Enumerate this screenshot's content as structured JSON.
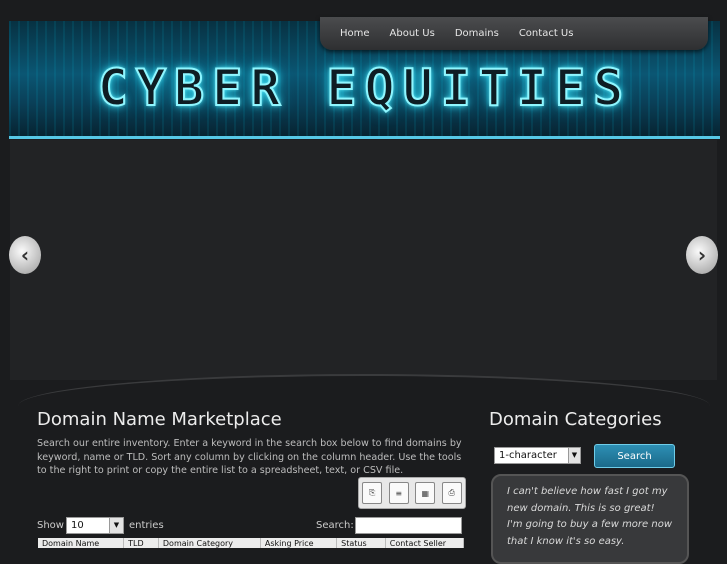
{
  "header": {
    "logo_text": "CYBER EQUITIES"
  },
  "nav": {
    "items": [
      {
        "label": "Home"
      },
      {
        "label": "About Us"
      },
      {
        "label": "Domains"
      },
      {
        "label": "Contact Us"
      }
    ]
  },
  "slider": {
    "prev_glyph": "‹",
    "next_glyph": "›"
  },
  "main": {
    "title": "Domain Name Marketplace",
    "intro": "Search our entire inventory. Enter a keyword in the search box below to find domains by keyword, name or TLD. Sort any column by clicking on the column header. Use the tools to the right to print or copy the entire list to a spreadsheet, text, or CSV file.",
    "tools": [
      "copy-icon",
      "csv-icon",
      "excel-icon",
      "print-icon"
    ],
    "show_label": "Show",
    "entries_value": "10",
    "entries_label": "entries",
    "search_label": "Search:",
    "search_value": "",
    "columns": [
      "Domain Name",
      "TLD",
      "Domain Category",
      "Asking Price",
      "Status",
      "Contact Seller"
    ]
  },
  "sidebar": {
    "title": "Domain Categories",
    "category_value": "1-character",
    "search_button": "Search",
    "testimonial": "I can't believe how fast I got my new domain. This is so great! I'm going to buy a few more now that I know it's so easy."
  },
  "colors": {
    "background": "#1b1c1e",
    "accent": "#1b6a8a",
    "banner_glow": "#3be0f5"
  }
}
